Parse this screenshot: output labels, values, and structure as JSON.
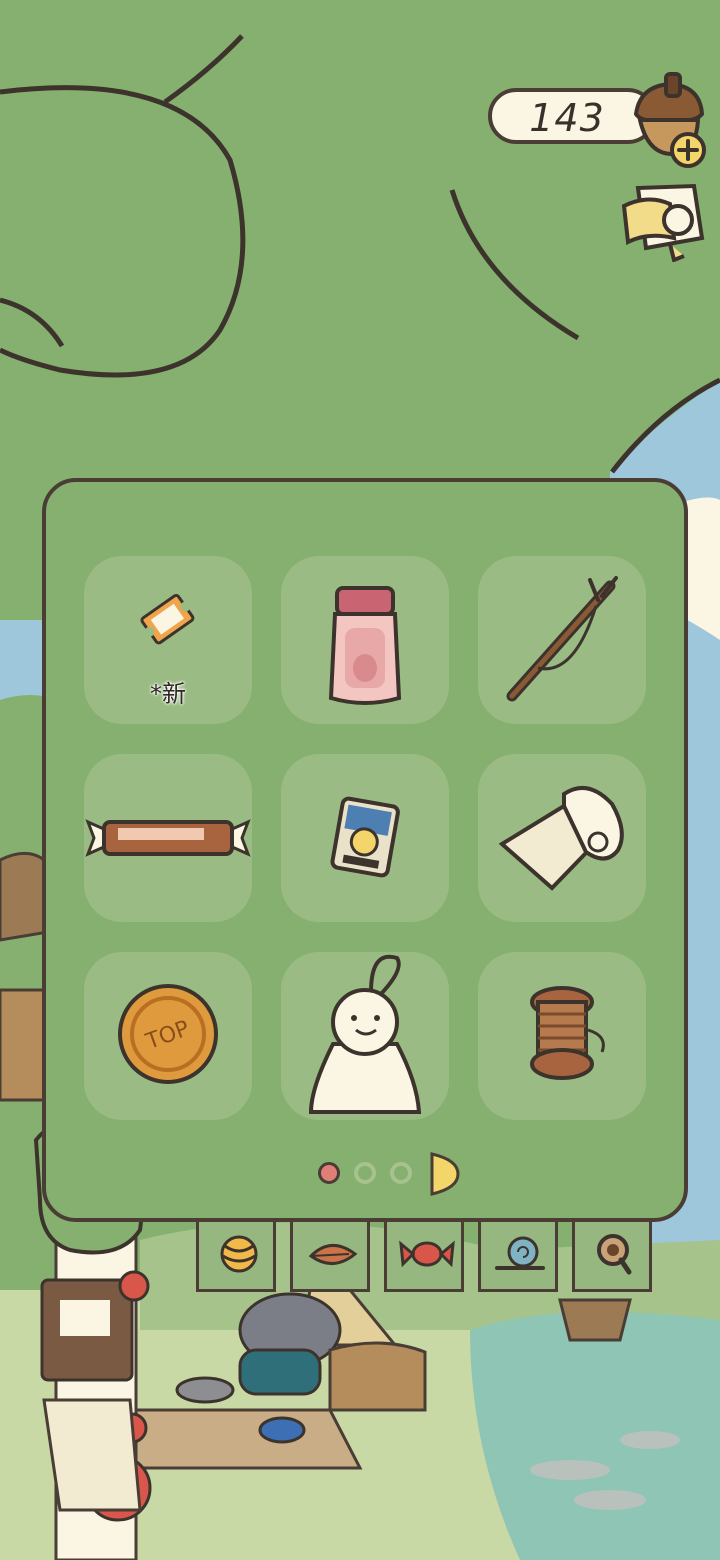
{
  "currency": {
    "value": "143",
    "icon": "acorn-icon",
    "add_icon": "plus-icon"
  },
  "letter_icon": "letter-icon",
  "inventory": {
    "items": [
      {
        "name": "ticket",
        "label": "*新"
      },
      {
        "name": "jar-bottle",
        "label": ""
      },
      {
        "name": "fishing-rod",
        "label": ""
      },
      {
        "name": "candy-bar",
        "label": ""
      },
      {
        "name": "tea-card",
        "label": ""
      },
      {
        "name": "paper-roll",
        "label": ""
      },
      {
        "name": "bottle-cap",
        "label": ""
      },
      {
        "name": "teru-teru-bozu",
        "label": ""
      },
      {
        "name": "thread-spool",
        "label": ""
      }
    ],
    "page_current": 1,
    "page_count": 3
  },
  "tabs": [
    {
      "name": "tab-yarn",
      "icon": "yarn-ball-icon"
    },
    {
      "name": "tab-leaf",
      "icon": "leaf-icon"
    },
    {
      "name": "tab-candy",
      "icon": "candy-icon"
    },
    {
      "name": "tab-snail",
      "icon": "snail-icon"
    },
    {
      "name": "tab-search",
      "icon": "magnifier-icon"
    }
  ],
  "colors": {
    "accent": "#e07f76",
    "panel": "#86b06f",
    "slot": "#9abc84",
    "outline": "#4a3d36"
  }
}
